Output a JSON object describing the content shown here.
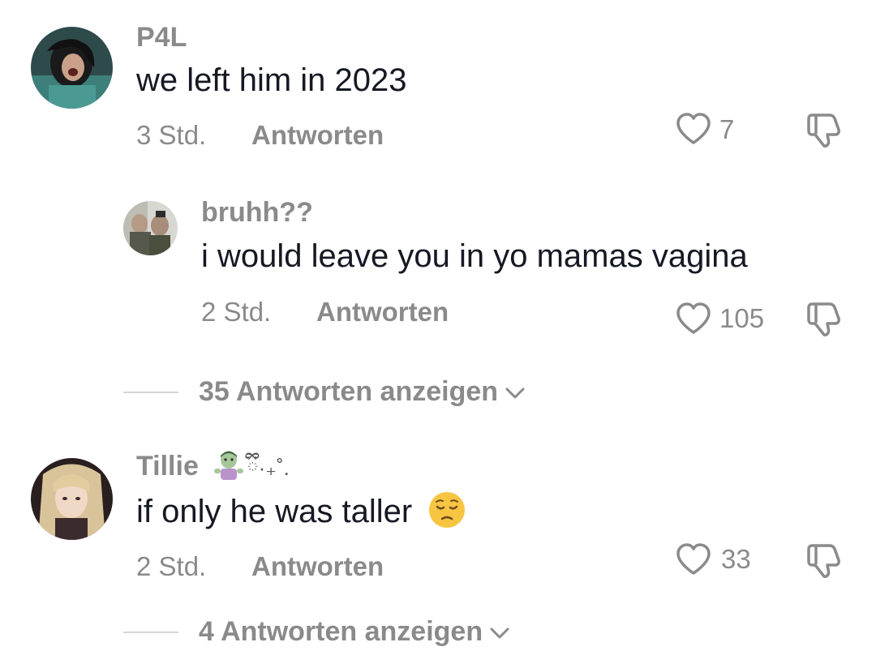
{
  "comments": [
    {
      "username": "P4L",
      "text": "we left him in 2023",
      "time": "3 Std.",
      "reply_label": "Antworten",
      "likes": "7"
    },
    {
      "username": "bruhh??",
      "text": "i would leave you in yo mamas vagina",
      "time": "2 Std.",
      "reply_label": "Antworten",
      "likes": "105"
    },
    {
      "username": "Tillie",
      "username_suffix": "ྀི·₊˚.",
      "text": "if only he was taller",
      "time": "2 Std.",
      "reply_label": "Antworten",
      "likes": "33"
    }
  ],
  "view_replies": [
    {
      "label": "35 Antworten anzeigen"
    },
    {
      "label": "4 Antworten anzeigen"
    }
  ],
  "colors": {
    "primary_text": "#161823",
    "secondary_text": "#8a8a8a",
    "background": "#ffffff",
    "divider": "#d6d6d6"
  }
}
